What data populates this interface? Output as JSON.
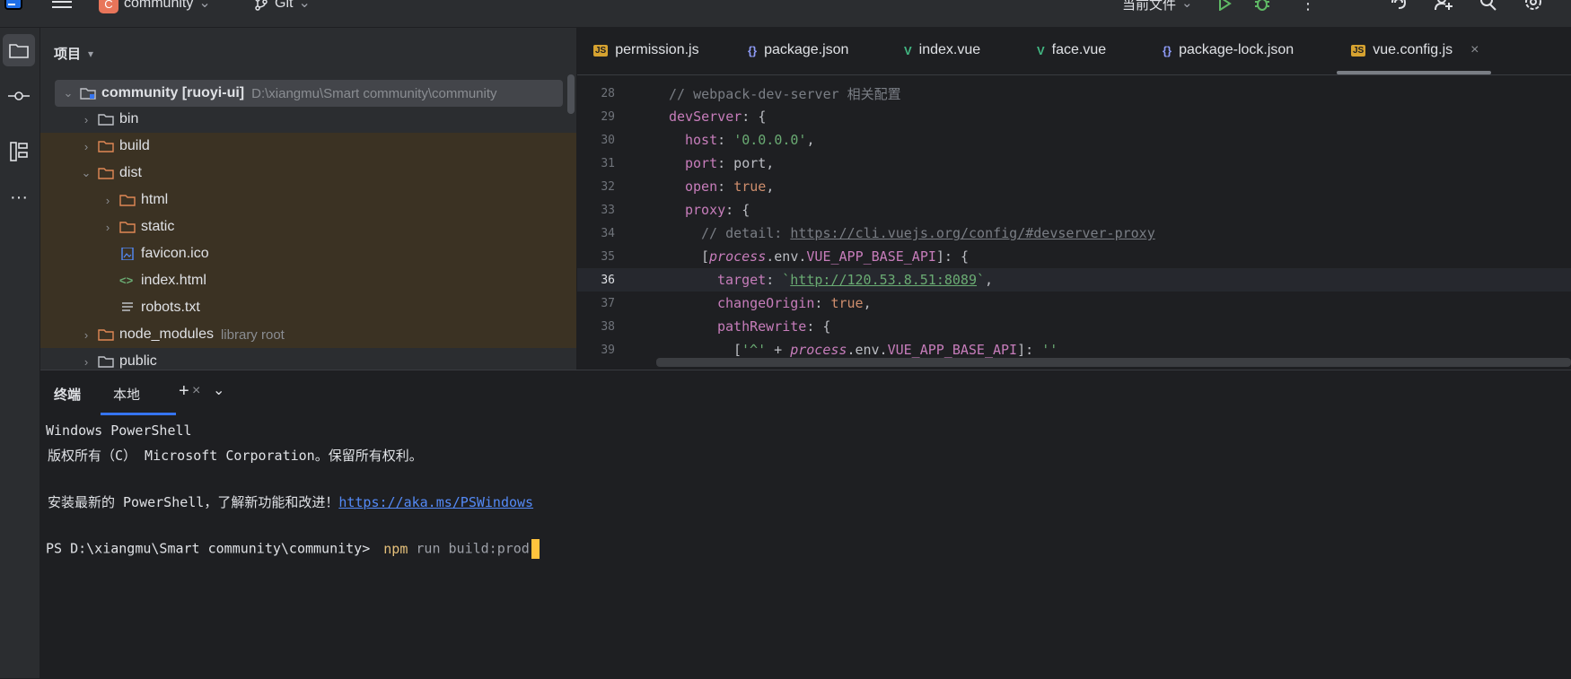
{
  "titlebar": {
    "project_badge": "C",
    "project_name": "community",
    "vcs": "Git",
    "current_file": "当前文件"
  },
  "project_panel": {
    "title": "项目",
    "root": {
      "name": "community [ruoyi-ui]",
      "path": "D:\\xiangmu\\Smart community\\community"
    },
    "items": [
      {
        "name": "bin",
        "type": "folder",
        "expanded": false,
        "level": 1
      },
      {
        "name": "build",
        "type": "folder",
        "expanded": false,
        "level": 1
      },
      {
        "name": "dist",
        "type": "folder",
        "expanded": true,
        "level": 1
      },
      {
        "name": "html",
        "type": "folder",
        "expanded": false,
        "level": 2
      },
      {
        "name": "static",
        "type": "folder",
        "expanded": false,
        "level": 2
      },
      {
        "name": "favicon.ico",
        "type": "image-file",
        "level": 2
      },
      {
        "name": "index.html",
        "type": "html-file",
        "level": 2
      },
      {
        "name": "robots.txt",
        "type": "text-file",
        "level": 2
      },
      {
        "name": "node_modules",
        "type": "folder",
        "expanded": false,
        "level": 1,
        "suffix": "library root"
      },
      {
        "name": "public",
        "type": "folder",
        "expanded": false,
        "level": 1
      }
    ]
  },
  "editor": {
    "tabs": [
      {
        "label": "permission.js",
        "icon": "JS"
      },
      {
        "label": "package.json",
        "icon": "{}"
      },
      {
        "label": "index.vue",
        "icon": "V"
      },
      {
        "label": "face.vue",
        "icon": "V"
      },
      {
        "label": "package-lock.json",
        "icon": "{}"
      },
      {
        "label": "vue.config.js",
        "icon": "JS",
        "active": true
      }
    ],
    "lines": [
      {
        "n": "28",
        "text": "// webpack-dev-server 相关配置"
      },
      {
        "n": "29",
        "text": "devServer: {"
      },
      {
        "n": "30",
        "text": "host: '0.0.0.0',"
      },
      {
        "n": "31",
        "text": "port: port,"
      },
      {
        "n": "32",
        "text": "open: true,"
      },
      {
        "n": "33",
        "text": "proxy: {"
      },
      {
        "n": "34",
        "text": "// detail: https://cli.vuejs.org/config/#devserver-proxy"
      },
      {
        "n": "35",
        "text": "[process.env.VUE_APP_BASE_API]: {"
      },
      {
        "n": "36",
        "text": "target: `http://120.53.8.51:8089`,"
      },
      {
        "n": "37",
        "text": "changeOrigin: true,"
      },
      {
        "n": "38",
        "text": "pathRewrite: {"
      },
      {
        "n": "39",
        "text": "['^' + process.env.VUE_APP_BASE_API]: ''"
      }
    ]
  },
  "terminal": {
    "title": "终端",
    "tab_label": "本地",
    "lines": [
      "Windows PowerShell",
      "版权所有（C） Microsoft Corporation。保留所有权利。",
      "",
      "安装最新的 PowerShell，了解新功能和改进！",
      "https://aka.ms/PSWindows",
      "PS D:\\xiangmu\\Smart community\\community>",
      "npm",
      "run build:prod"
    ]
  },
  "colors": {
    "accent": "#3574f0",
    "highlight_row": "#3b3223",
    "cursor": "#ffc33d",
    "run_green": "#5fb865"
  }
}
